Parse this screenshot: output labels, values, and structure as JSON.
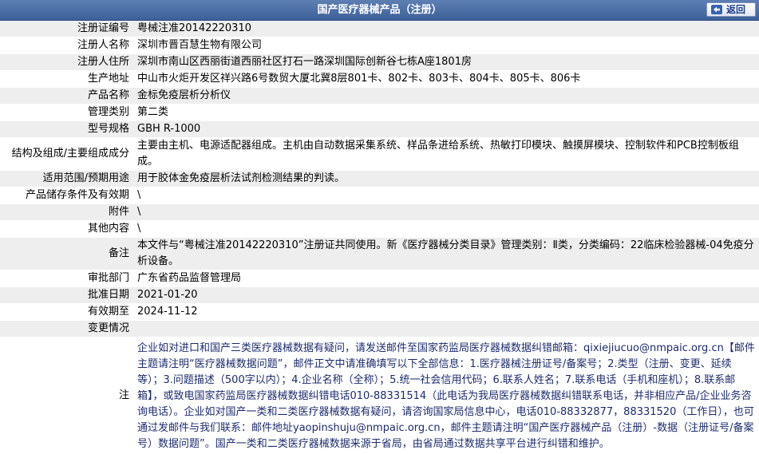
{
  "header": {
    "title": "国产医疗器械产品（注册）",
    "back_label": "返回"
  },
  "rows": [
    {
      "label": "注册证编号",
      "value": "粤械注准20142220310"
    },
    {
      "label": "注册人名称",
      "value": "深圳市晋百慧生物有限公司"
    },
    {
      "label": "注册人住所",
      "value": "深圳市南山区西丽街道西丽社区打石一路深圳国际创新谷七栋A座1801房"
    },
    {
      "label": "生产地址",
      "value": "中山市火炬开发区祥兴路6号数贸大厦北冀8层801卡、802卡、803卡、804卡、805卡、806卡"
    },
    {
      "label": "产品名称",
      "value": "金标免疫层析分析仪"
    },
    {
      "label": "管理类别",
      "value": "第二类"
    },
    {
      "label": "型号规格",
      "value": "GBH R-1000"
    },
    {
      "label": "结构及组成/主要组成成分",
      "value": "主要由主机、电源适配器组成。主机由自动数据采集系统、样品条进给系统、热敏打印模块、触摸屏模块、控制软件和PCB控制板组成。"
    },
    {
      "label": "适用范围/预期用途",
      "value": "用于胶体金免疫层析法试剂检测结果的判读。"
    },
    {
      "label": "产品储存条件及有效期",
      "value": "\\"
    },
    {
      "label": "附件",
      "value": "\\"
    },
    {
      "label": "其他内容",
      "value": "\\"
    },
    {
      "label": "备注",
      "value": "本文件与“粤械注准20142220310”注册证共同使用。新《医疗器械分类目录》管理类别：Ⅱ类，分类编码：22临床检验器械-04免疫分析设备。"
    },
    {
      "label": "审批部门",
      "value": "广东省药品监督管理局"
    },
    {
      "label": "批准日期",
      "value": "2021-01-20"
    },
    {
      "label": "有效期至",
      "value": "2024-11-12"
    },
    {
      "label": "变更情况",
      "value": ""
    }
  ],
  "note": {
    "label": "注",
    "text": "企业如对进口和国产三类医疗器械数据有疑问，请发送邮件至国家药监局医疗器械数据纠错邮箱：qixiejiucuo@nmpaic.org.cn【邮件主题请注明“医疗器械数据问题”，邮件正文中请准确填写以下全部信息：1.医疗器械注册证号/备案号；2.类型（注册、变更、延续等）；3.问题描述（500字以内）；4.企业名称（全称）；5.统一社会信用代码；6.联系人姓名；7.联系电话（手机和座机）；8.联系邮箱】，或致电国家药监局医疗器械数据纠错电话010-88331514（此电话为我局医疗器械数据纠错联系电话，并非相应产品/企业业务咨询电话）。企业如对国产一类和二类医疗器械数据有疑问，请咨询国家局信息中心，电话010-88332877，88331520（工作日），也可通过发邮件与我们联系：邮件地址yaopinshuju@nmpaic.org.cn，邮件主题请注明“国产医疗器械产品（注册）-数据（注册证号/备案号）数据问题”。国产一类和二类医疗器械数据来源于省局，由省局通过数据共享平台进行纠错和维护。"
  },
  "colors": {
    "header_bg": "#4a6ea8",
    "row_alt": "#eeeeee",
    "note_text": "#1b2c6e"
  }
}
